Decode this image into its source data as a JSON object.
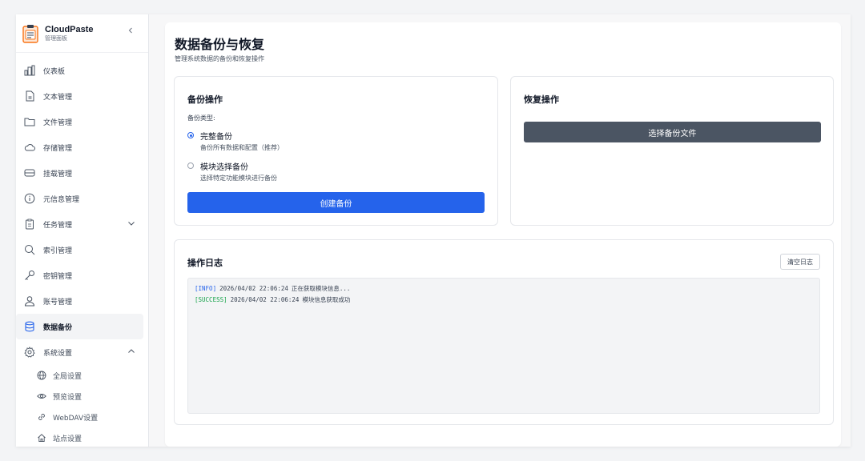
{
  "brand": {
    "title": "CloudPaste",
    "subtitle": "管理面板"
  },
  "sidebar": {
    "items": [
      {
        "label": "仪表板",
        "icon": "bar-chart-icon"
      },
      {
        "label": "文本管理",
        "icon": "document-icon"
      },
      {
        "label": "文件管理",
        "icon": "folder-icon"
      },
      {
        "label": "存储管理",
        "icon": "cloud-icon"
      },
      {
        "label": "挂载管理",
        "icon": "drive-icon"
      },
      {
        "label": "元信息管理",
        "icon": "info-icon"
      },
      {
        "label": "任务管理",
        "icon": "clipboard-icon"
      },
      {
        "label": "索引管理",
        "icon": "search-icon"
      },
      {
        "label": "密钥管理",
        "icon": "key-icon"
      },
      {
        "label": "账号管理",
        "icon": "user-icon"
      },
      {
        "label": "数据备份",
        "icon": "database-icon"
      },
      {
        "label": "系统设置",
        "icon": "gear-icon"
      }
    ],
    "subitems": [
      {
        "label": "全局设置",
        "icon": "globe-icon"
      },
      {
        "label": "预览设置",
        "icon": "eye-icon"
      },
      {
        "label": "WebDAV设置",
        "icon": "link-icon"
      },
      {
        "label": "站点设置",
        "icon": "home-icon"
      }
    ]
  },
  "page": {
    "title": "数据备份与恢复",
    "subtitle": "管理系统数据的备份和恢复操作"
  },
  "backup": {
    "title": "备份操作",
    "type_label": "备份类型:",
    "options": [
      {
        "label": "完整备份",
        "desc": "备份所有数据和配置（推荐）",
        "checked": true
      },
      {
        "label": "模块选择备份",
        "desc": "选择特定功能模块进行备份",
        "checked": false
      }
    ],
    "create_label": "创建备份"
  },
  "restore": {
    "title": "恢复操作",
    "select_label": "选择备份文件"
  },
  "log": {
    "title": "操作日志",
    "clear_label": "清空日志",
    "entries": [
      {
        "level": "[INFO]",
        "time": "2026/04/02 22:06:24",
        "message": "正在获取模块信息..."
      },
      {
        "level": "[SUCCESS]",
        "time": "2026/04/02 22:06:24",
        "message": "模块信息获取成功"
      }
    ]
  },
  "colors": {
    "primary": "#2563eb",
    "dark_button": "#4b5563",
    "info": "#2563eb",
    "success": "#16a34a"
  }
}
